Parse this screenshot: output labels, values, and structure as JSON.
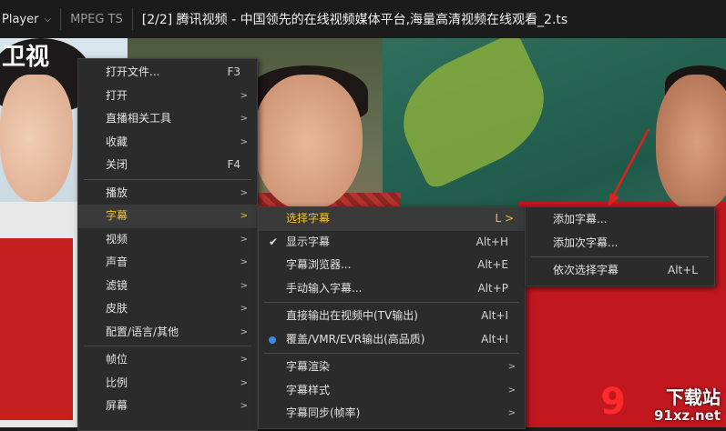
{
  "window": {
    "player_label": "Player",
    "format": "MPEG TS",
    "title": "[2/2] 腾讯视频 - 中国领先的在线视频媒体平台,海量高清视频在线观看_2.ts"
  },
  "video": {
    "channel_logo": "卫视",
    "watermark": {
      "brand": "下载站",
      "url": "91xz.net"
    }
  },
  "main_menu": {
    "items": [
      {
        "label": "打开文件...",
        "shortcut": "F3"
      },
      {
        "label": "打开",
        "arrow": ">"
      },
      {
        "label": "直播相关工具",
        "arrow": ">"
      },
      {
        "label": "收藏",
        "arrow": ">"
      },
      {
        "label": "关闭",
        "shortcut": "F4"
      },
      {
        "label": "播放",
        "arrow": ">"
      },
      {
        "label": "字幕",
        "arrow": ">"
      },
      {
        "label": "视频",
        "arrow": ">"
      },
      {
        "label": "声音",
        "arrow": ">"
      },
      {
        "label": "滤镜",
        "arrow": ">"
      },
      {
        "label": "皮肤",
        "arrow": ">"
      },
      {
        "label": "配置/语言/其他",
        "arrow": ">"
      },
      {
        "label": "帧位",
        "arrow": ">"
      },
      {
        "label": "比例",
        "arrow": ">"
      },
      {
        "label": "屏幕",
        "arrow": ">"
      }
    ]
  },
  "subtitle_menu": {
    "items": [
      {
        "label": "选择字幕",
        "shortcut": "L >"
      },
      {
        "label": "显示字幕",
        "shortcut": "Alt+H",
        "icon": "check-icon"
      },
      {
        "label": "字幕浏览器...",
        "shortcut": "Alt+E"
      },
      {
        "label": "手动输入字幕...",
        "shortcut": "Alt+P"
      },
      {
        "label": "直接输出在视频中(TV输出)",
        "shortcut": "Alt+I"
      },
      {
        "label": "覆盖/VMR/EVR输出(高品质)",
        "shortcut": "Alt+I",
        "icon": "radio-selected-icon"
      },
      {
        "label": "字幕渲染",
        "arrow": ">"
      },
      {
        "label": "字幕样式",
        "arrow": ">"
      },
      {
        "label": "字幕同步(帧率)",
        "arrow": ">"
      }
    ]
  },
  "select_subtitle_menu": {
    "items": [
      {
        "label": "添加字幕..."
      },
      {
        "label": "添加次字幕..."
      },
      {
        "label": "依次选择字幕",
        "shortcut": "Alt+L"
      }
    ]
  },
  "colors": {
    "highlight_text": "#f1c232",
    "menu_bg": "#2b2b2b",
    "radio_blue": "#3a8be6",
    "arrow_red": "#e0201c"
  }
}
